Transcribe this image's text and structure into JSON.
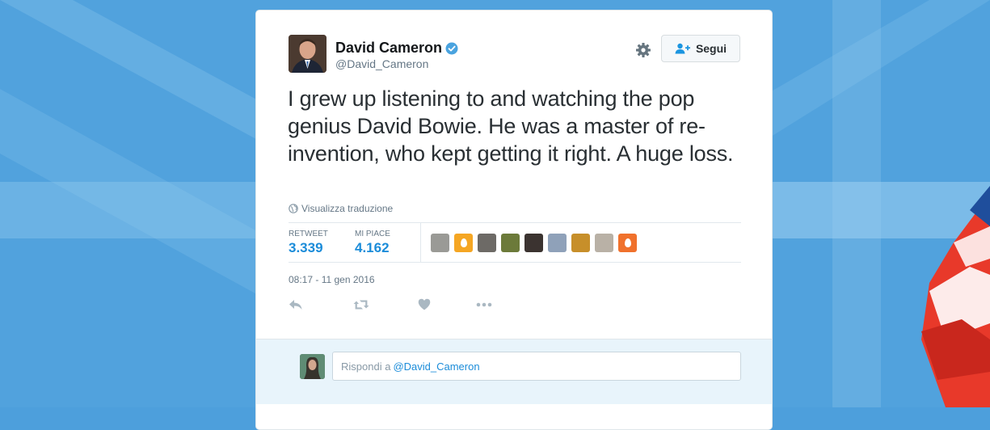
{
  "tweet": {
    "author_name": "David Cameron",
    "author_handle": "@David_Cameron",
    "verified": true,
    "follow_label": "Segui",
    "text": "I grew up listening to and watching the pop genius David Bowie. He was a master of re-invention, who kept getting it right. A huge loss.",
    "translate_label": "Visualizza traduzione",
    "stats": {
      "retweets_label": "RETWEET",
      "retweets_value": "3.339",
      "likes_label": "MI PIACE",
      "likes_value": "4.162"
    },
    "likers": [
      {
        "icon": "avatar",
        "color": "#9a9a96"
      },
      {
        "icon": "egg-icon",
        "color": "#f5a623"
      },
      {
        "icon": "avatar",
        "color": "#6d6a66"
      },
      {
        "icon": "avatar",
        "color": "#6c7a3a"
      },
      {
        "icon": "avatar",
        "color": "#3b3330"
      },
      {
        "icon": "avatar",
        "color": "#8fa1b9"
      },
      {
        "icon": "avatar",
        "color": "#c78f2a"
      },
      {
        "icon": "avatar",
        "color": "#b9b1a6"
      },
      {
        "icon": "egg-icon",
        "color": "#f0712c"
      }
    ],
    "timestamp": "08:17 - 11 gen 2016",
    "actions": [
      "reply-icon",
      "retweet-icon",
      "like-icon",
      "more-icon"
    ]
  },
  "reply": {
    "prefix": "Rispondi a",
    "mention": "@David_Cameron"
  },
  "colors": {
    "link": "#1b8cd9",
    "verified": "#4aa3df",
    "background": "#4d9fdc"
  }
}
